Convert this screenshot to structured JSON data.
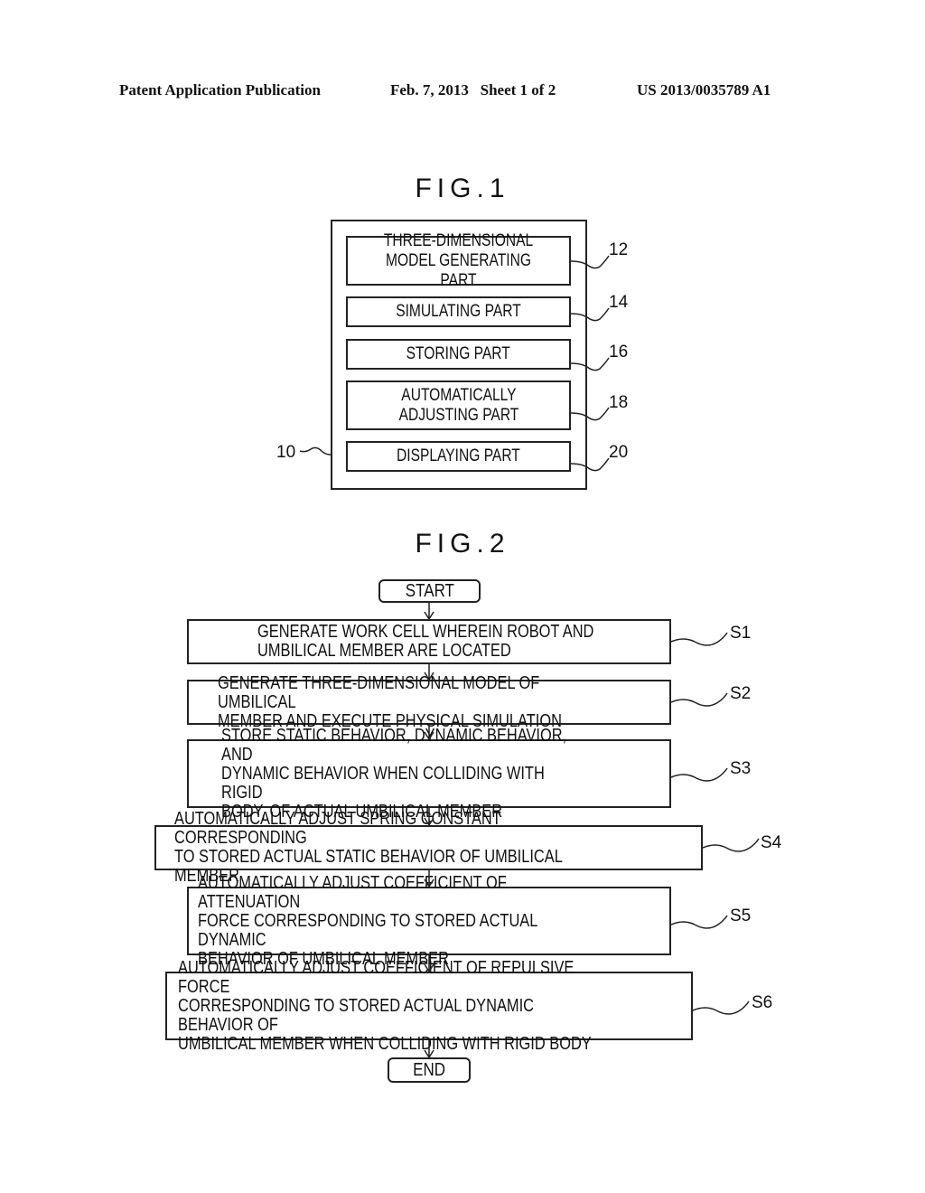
{
  "header": {
    "publication": "Patent Application Publication",
    "date_sheet": "Feb. 7, 2013   Sheet 1 of 2",
    "number": "US 2013/0035789 A1"
  },
  "fig1": {
    "title": "FIG.1",
    "outer_ref": "10",
    "parts": [
      {
        "label": "THREE-DIMENSIONAL\nMODEL GENERATING PART",
        "ref": "12"
      },
      {
        "label": "SIMULATING PART",
        "ref": "14"
      },
      {
        "label": "STORING PART",
        "ref": "16"
      },
      {
        "label": "AUTOMATICALLY\nADJUSTING PART",
        "ref": "18"
      },
      {
        "label": "DISPLAYING PART",
        "ref": "20"
      }
    ]
  },
  "fig2": {
    "title": "FIG.2",
    "start": "START",
    "end": "END",
    "steps": [
      {
        "id": "S1",
        "text": "GENERATE WORK CELL WHEREIN ROBOT AND\nUMBILICAL MEMBER ARE LOCATED"
      },
      {
        "id": "S2",
        "text": "GENERATE THREE-DIMENSIONAL MODEL OF UMBILICAL\nMEMBER AND EXECUTE PHYSICAL SIMULATION"
      },
      {
        "id": "S3",
        "text": "STORE STATIC BEHAVIOR, DYNAMIC BEHAVIOR, AND\nDYNAMIC BEHAVIOR WHEN COLLIDING WITH RIGID\nBODY, OF ACTUAL UMBILICAL MEMBER"
      },
      {
        "id": "S4",
        "text": "AUTOMATICALLY ADJUST SPRING CONSTANT CORRESPONDING\nTO STORED ACTUAL STATIC BEHAVIOR OF UMBILICAL MEMBER"
      },
      {
        "id": "S5",
        "text": "AUTOMATICALLY ADJUST COEFFICIENT OF ATTENUATION\nFORCE CORRESPONDING TO STORED ACTUAL DYNAMIC\nBEHAVIOR OF UMBILICAL MEMBER"
      },
      {
        "id": "S6",
        "text": "AUTOMATICALLY ADJUST COEFFICIENT OF REPULSIVE FORCE\nCORRESPONDING TO STORED ACTUAL DYNAMIC BEHAVIOR OF\nUMBILICAL MEMBER WHEN COLLIDING WITH RIGID BODY"
      }
    ]
  }
}
